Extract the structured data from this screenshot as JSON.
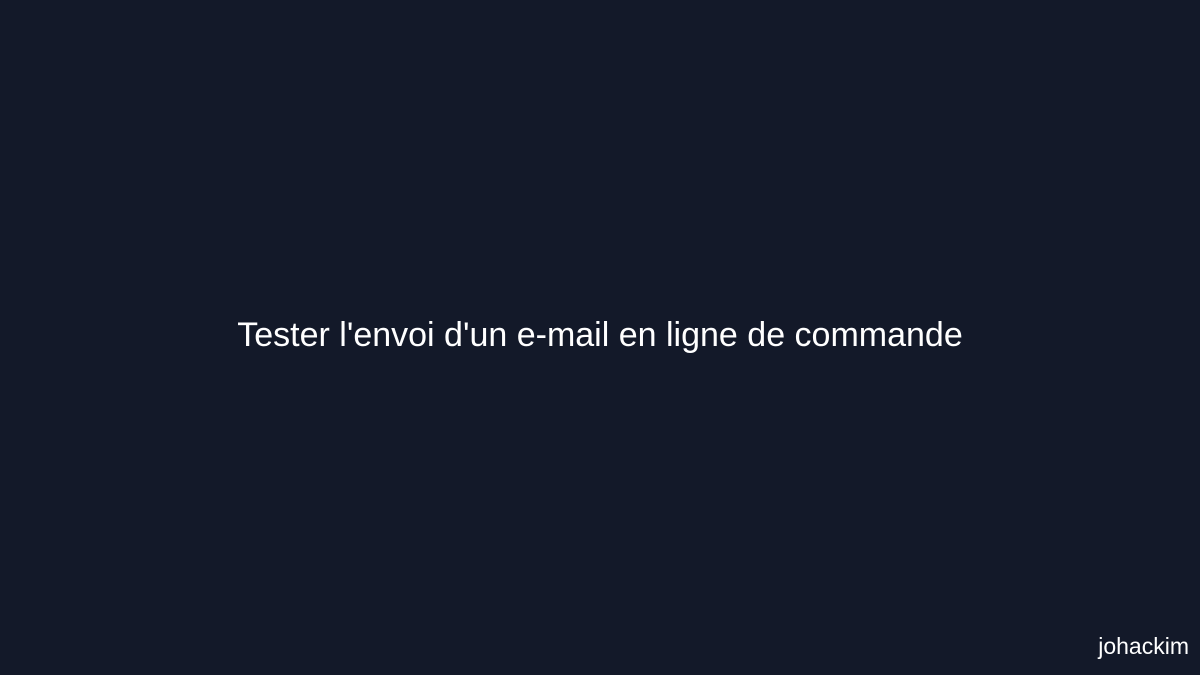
{
  "slide": {
    "title": "Tester l'envoi d'un e-mail en ligne de commande",
    "author": "johackim"
  },
  "colors": {
    "background": "#131929",
    "text": "#ffffff"
  }
}
